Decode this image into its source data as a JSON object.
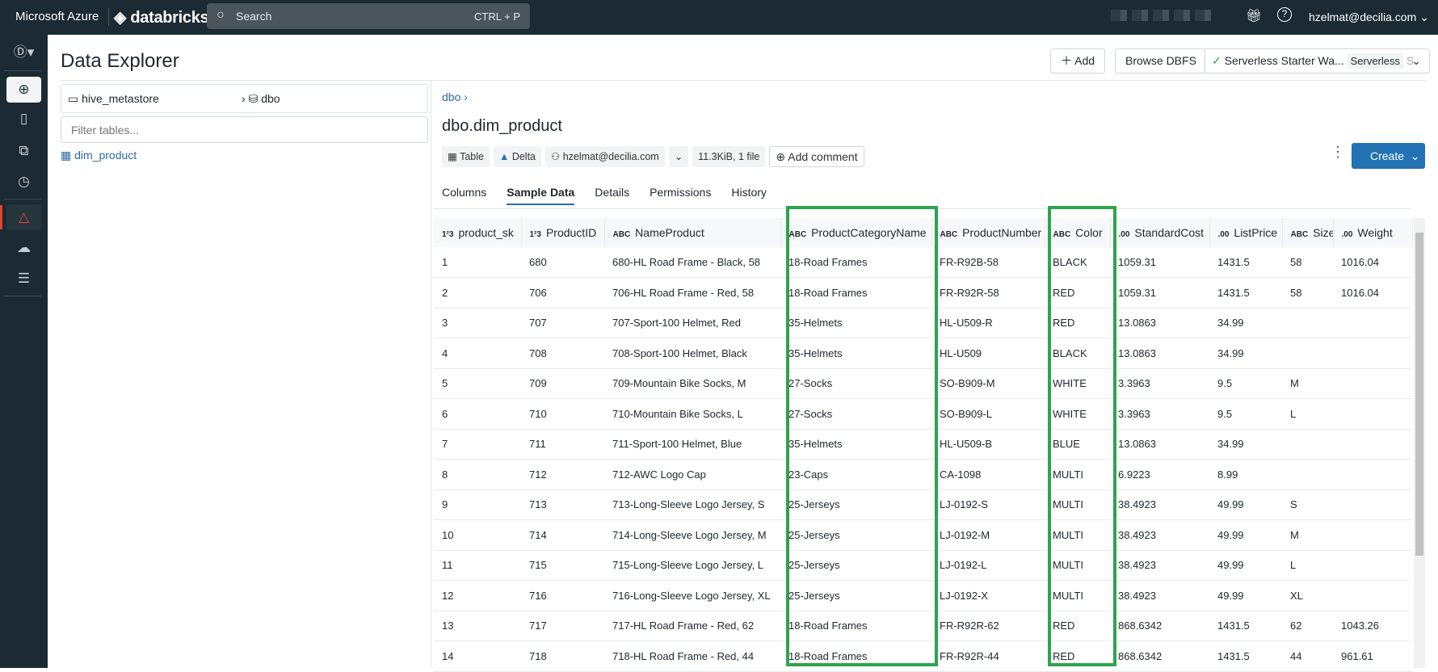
{
  "topbar": {
    "brand": "Microsoft Azure",
    "product": "databricks",
    "search_placeholder": "Search",
    "search_shortcut": "CTRL + P",
    "user": "hzelmat@decilia.com"
  },
  "page": {
    "title": "Data Explorer"
  },
  "left_panel": {
    "catalog": "hive_metastore",
    "schema": "dbo",
    "filter_placeholder": "Filter tables...",
    "tables": [
      "dim_product"
    ]
  },
  "toolbar": {
    "add": "Add",
    "browse": "Browse DBFS",
    "warehouse": "Serverless Starter Wa...",
    "warehouse_badge": "Serverless",
    "warehouse_size": "S"
  },
  "detail": {
    "breadcrumb": "dbo",
    "title": "dbo.dim_product",
    "chips": {
      "type": "Table",
      "format": "Delta",
      "owner": "hzelmat@decilia.com",
      "size": "11.3KiB, 1 file",
      "comment": "Add comment"
    },
    "create": "Create",
    "tabs": [
      "Columns",
      "Sample Data",
      "Details",
      "Permissions",
      "History"
    ],
    "active_tab": "Sample Data"
  },
  "table": {
    "columns": [
      {
        "name": "product_sk",
        "type": "1²3"
      },
      {
        "name": "ProductID",
        "type": "1²3"
      },
      {
        "name": "NameProduct",
        "type": "ABC"
      },
      {
        "name": "ProductCategoryName",
        "type": "ABC"
      },
      {
        "name": "ProductNumber",
        "type": "ABC"
      },
      {
        "name": "Color",
        "type": "ABC"
      },
      {
        "name": "StandardCost",
        "type": ".00"
      },
      {
        "name": "ListPrice",
        "type": ".00"
      },
      {
        "name": "Size",
        "type": "ABC"
      },
      {
        "name": "Weight",
        "type": ".00"
      }
    ],
    "rows": [
      [
        "1",
        "680",
        "680-HL Road Frame - Black, 58",
        "18-Road Frames",
        "FR-R92B-58",
        "BLACK",
        "1059.31",
        "1431.5",
        "58",
        "1016.04"
      ],
      [
        "2",
        "706",
        "706-HL Road Frame - Red, 58",
        "18-Road Frames",
        "FR-R92R-58",
        "RED",
        "1059.31",
        "1431.5",
        "58",
        "1016.04"
      ],
      [
        "3",
        "707",
        "707-Sport-100 Helmet, Red",
        "35-Helmets",
        "HL-U509-R",
        "RED",
        "13.0863",
        "34.99",
        "",
        ""
      ],
      [
        "4",
        "708",
        "708-Sport-100 Helmet, Black",
        "35-Helmets",
        "HL-U509",
        "BLACK",
        "13.0863",
        "34.99",
        "",
        ""
      ],
      [
        "5",
        "709",
        "709-Mountain Bike Socks, M",
        "27-Socks",
        "SO-B909-M",
        "WHITE",
        "3.3963",
        "9.5",
        "M",
        ""
      ],
      [
        "6",
        "710",
        "710-Mountain Bike Socks, L",
        "27-Socks",
        "SO-B909-L",
        "WHITE",
        "3.3963",
        "9.5",
        "L",
        ""
      ],
      [
        "7",
        "711",
        "711-Sport-100 Helmet, Blue",
        "35-Helmets",
        "HL-U509-B",
        "BLUE",
        "13.0863",
        "34.99",
        "",
        ""
      ],
      [
        "8",
        "712",
        "712-AWC Logo Cap",
        "23-Caps",
        "CA-1098",
        "MULTI",
        "6.9223",
        "8.99",
        "",
        ""
      ],
      [
        "9",
        "713",
        "713-Long-Sleeve Logo Jersey, S",
        "25-Jerseys",
        "LJ-0192-S",
        "MULTI",
        "38.4923",
        "49.99",
        "S",
        ""
      ],
      [
        "10",
        "714",
        "714-Long-Sleeve Logo Jersey, M",
        "25-Jerseys",
        "LJ-0192-M",
        "MULTI",
        "38.4923",
        "49.99",
        "M",
        ""
      ],
      [
        "11",
        "715",
        "715-Long-Sleeve Logo Jersey, L",
        "25-Jerseys",
        "LJ-0192-L",
        "MULTI",
        "38.4923",
        "49.99",
        "L",
        ""
      ],
      [
        "12",
        "716",
        "716-Long-Sleeve Logo Jersey, XL",
        "25-Jerseys",
        "LJ-0192-X",
        "MULTI",
        "38.4923",
        "49.99",
        "XL",
        ""
      ],
      [
        "13",
        "717",
        "717-HL Road Frame - Red, 62",
        "18-Road Frames",
        "FR-R92R-62",
        "RED",
        "868.6342",
        "1431.5",
        "62",
        "1043.26"
      ],
      [
        "14",
        "718",
        "718-HL Road Frame - Red, 44",
        "18-Road Frames",
        "FR-R92R-44",
        "RED",
        "868.6342",
        "1431.5",
        "44",
        "961.61"
      ]
    ]
  },
  "colors": {
    "highlight": "#2da44e",
    "primary": "#2272b4",
    "topbar": "#1b2a33"
  }
}
